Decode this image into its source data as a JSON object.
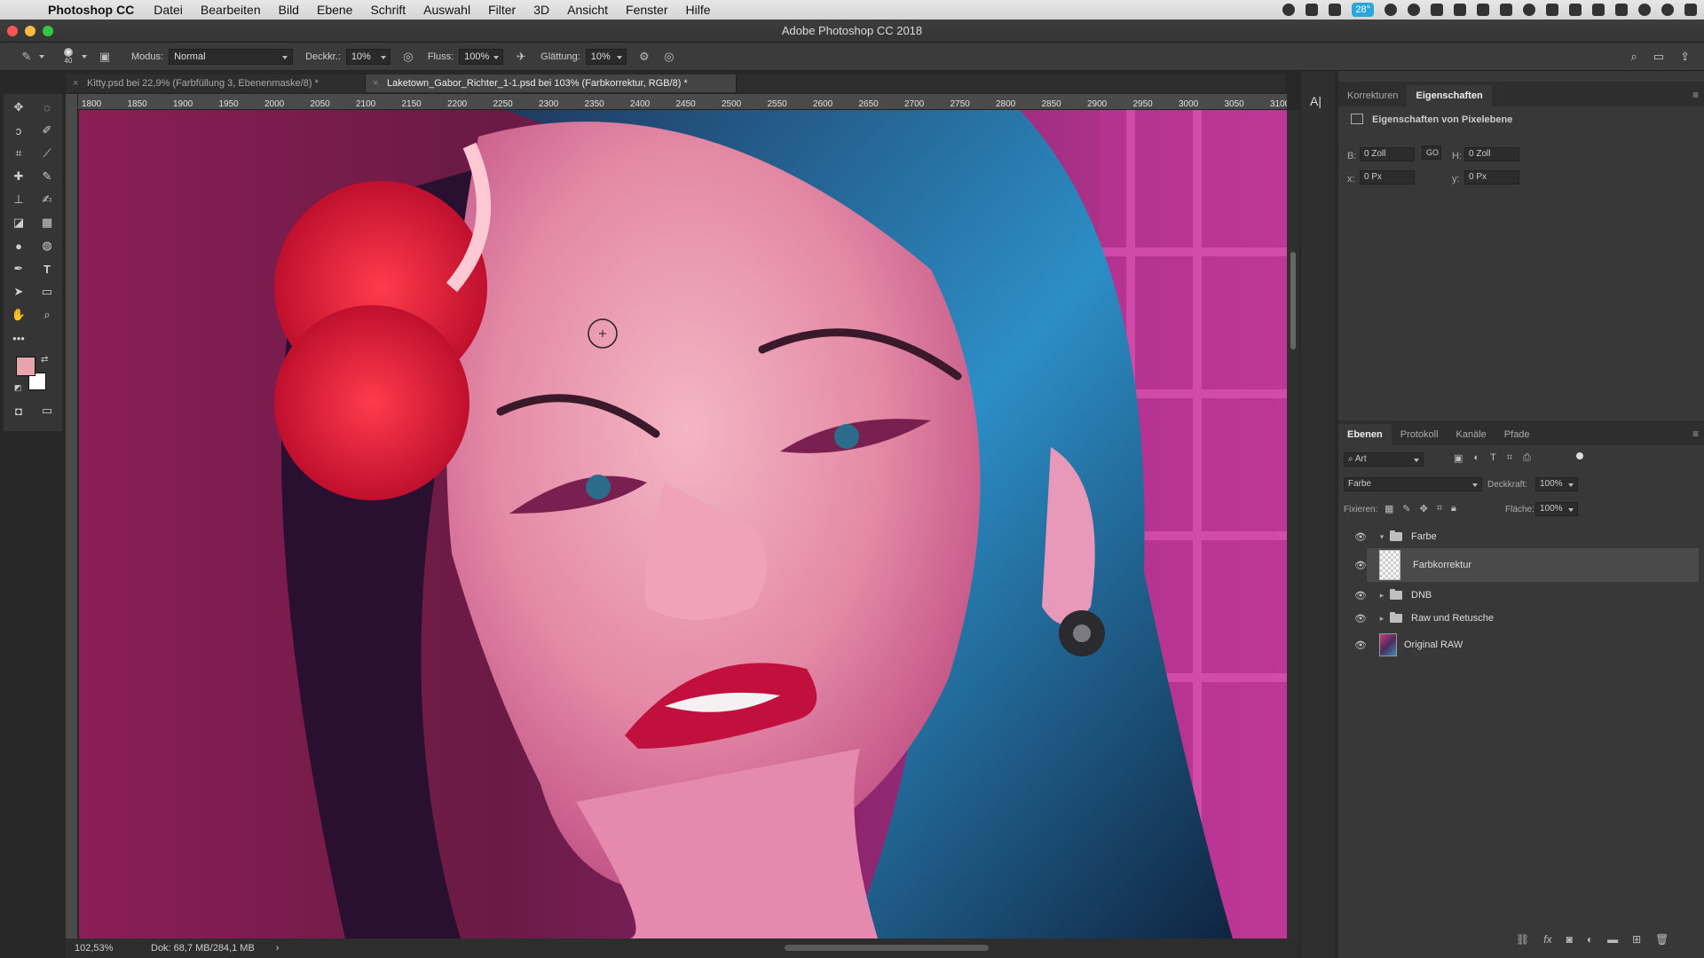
{
  "menubar": {
    "app": "Photoshop CC",
    "items": [
      "Datei",
      "Bearbeiten",
      "Bild",
      "Ebene",
      "Schrift",
      "Auswahl",
      "Filter",
      "3D",
      "Ansicht",
      "Fenster",
      "Hilfe"
    ],
    "weather": "28°"
  },
  "window": {
    "title": "Adobe Photoshop CC 2018"
  },
  "options": {
    "brush_size": "40",
    "mode_label": "Modus:",
    "mode_value": "Normal",
    "opacity_label": "Deckkr.:",
    "opacity_value": "10%",
    "flow_label": "Fluss:",
    "flow_value": "100%",
    "smoothing_label": "Glättung:",
    "smoothing_value": "10%"
  },
  "tabs": [
    {
      "label": "Kitty.psd bei 22,9% (Farbfüllung 3, Ebenenmaske/8) *"
    },
    {
      "label": "Laketown_Gabor_Richter_1-1.psd bei 103% (Farbkorrektur, RGB/8) *"
    }
  ],
  "ruler": {
    "top": [
      "1800",
      "1850",
      "1900",
      "1950",
      "2000",
      "2050",
      "2100",
      "2150",
      "2200",
      "2250",
      "2300",
      "2350",
      "2400",
      "2450",
      "2500",
      "2550",
      "2600",
      "2650",
      "2700",
      "2750",
      "2800",
      "2850",
      "2900",
      "2950",
      "3000",
      "3050",
      "3100"
    ]
  },
  "status": {
    "zoom": "102,53%",
    "doc": "Dok: 68,7 MB/284,1 MB",
    "arrow": "›"
  },
  "properties": {
    "tabs": [
      "Korrekturen",
      "Eigenschaften"
    ],
    "header": "Eigenschaften von Pixelebene",
    "b_label": "B:",
    "b_value": "0 Zoll",
    "h_label": "H:",
    "h_value": "0 Zoll",
    "x_label": "x:",
    "x_value": "0 Px",
    "y_label": "y:",
    "y_value": "0 Px",
    "link": "GO"
  },
  "layers_panel": {
    "tabs": [
      "Ebenen",
      "Protokoll",
      "Kanäle",
      "Pfade"
    ],
    "filter_value": "Art",
    "blend_value": "Farbe",
    "opacity_label": "Deckkraft:",
    "opacity_value": "100%",
    "lock_label": "Fixieren:",
    "fill_label": "Fläche:",
    "fill_value": "100%",
    "layers": [
      {
        "name": "Farbe"
      },
      {
        "name": "Farbkorrektur"
      },
      {
        "name": "DNB"
      },
      {
        "name": "Raw und Retusche"
      },
      {
        "name": "Original RAW"
      }
    ]
  },
  "colors": {
    "accent": "#e2326f",
    "foreground_swatch": "#e8a4ac",
    "background_swatch": "#ffffff"
  }
}
